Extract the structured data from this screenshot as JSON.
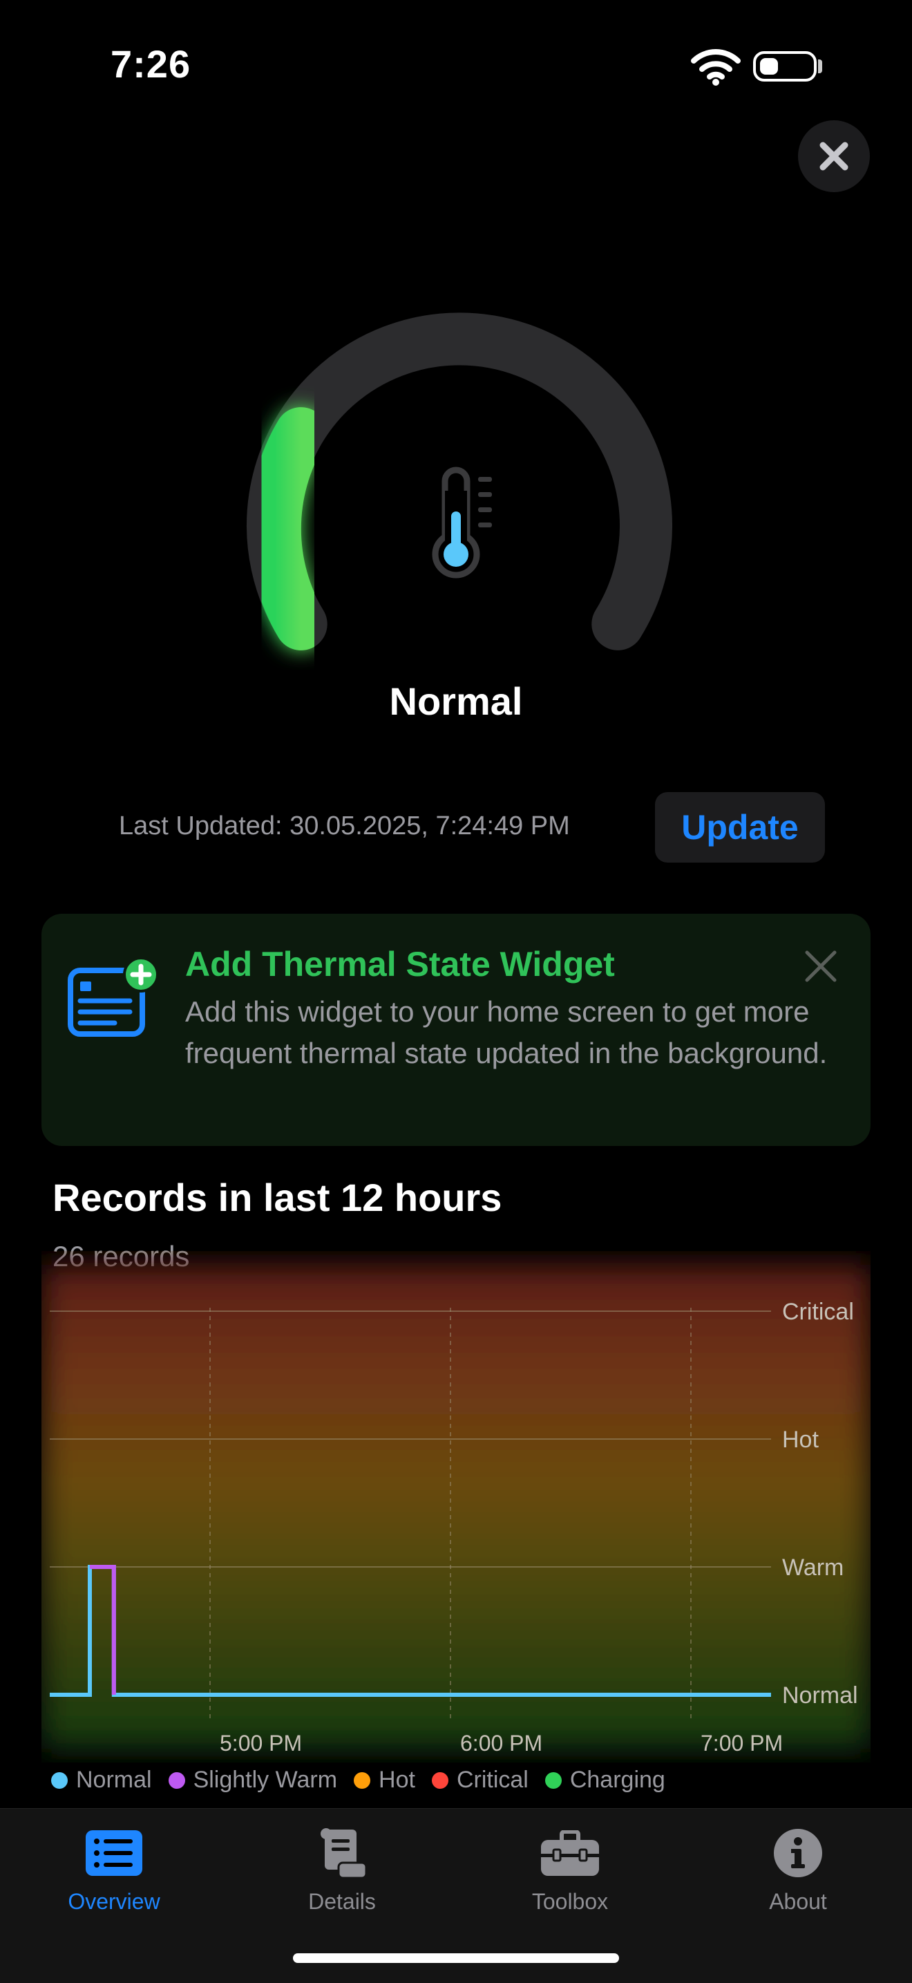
{
  "status_bar": {
    "time": "7:26"
  },
  "gauge": {
    "state": "Normal",
    "level_fraction": 0.25,
    "colors": {
      "active": "#34d158",
      "track": "#2c2c2e",
      "thermo": "#5ac8fa"
    }
  },
  "update": {
    "last_updated": "Last Updated: 30.05.2025, 7:24:49 PM",
    "button_label": "Update"
  },
  "widget_promo": {
    "title": "Add Thermal State Widget",
    "description": "Add this widget to your home screen to get more frequent thermal state updated in the background."
  },
  "records": {
    "title": "Records in last 12 hours",
    "count_label": "26 records"
  },
  "chart_data": {
    "type": "line",
    "title": "",
    "y_categories": [
      "Normal",
      "Warm",
      "Hot",
      "Critical"
    ],
    "x_ticks": [
      "5:00 PM",
      "6:00 PM",
      "7:00 PM"
    ],
    "x_range": [
      "4:20 PM",
      "7:20 PM"
    ],
    "series": [
      {
        "name": "Normal",
        "color": "#5ac8fa",
        "points": [
          [
            "4:20 PM",
            "Normal"
          ],
          [
            "4:30 PM",
            "Normal"
          ],
          [
            "4:30 PM",
            "Warm"
          ],
          [
            "4:36 PM",
            "Warm"
          ],
          [
            "4:36 PM",
            "Normal"
          ],
          [
            "7:20 PM",
            "Normal"
          ]
        ]
      },
      {
        "name": "Slightly Warm",
        "color": "#bf5af2",
        "points": [
          [
            "4:30 PM",
            "Warm"
          ],
          [
            "4:36 PM",
            "Warm"
          ],
          [
            "4:36 PM",
            "Normal"
          ]
        ]
      }
    ],
    "legend": [
      {
        "name": "Normal",
        "color": "#5ac8fa"
      },
      {
        "name": "Slightly Warm",
        "color": "#bf5af2"
      },
      {
        "name": "Hot",
        "color": "#ff9f0a"
      },
      {
        "name": "Critical",
        "color": "#ff453a"
      },
      {
        "name": "Charging",
        "color": "#30d158"
      }
    ],
    "grid": true
  },
  "tabs": [
    {
      "label": "Overview",
      "active": true,
      "icon": "list-icon"
    },
    {
      "label": "Details",
      "active": false,
      "icon": "scroll-icon"
    },
    {
      "label": "Toolbox",
      "active": false,
      "icon": "toolbox-icon"
    },
    {
      "label": "About",
      "active": false,
      "icon": "info-icon"
    }
  ]
}
